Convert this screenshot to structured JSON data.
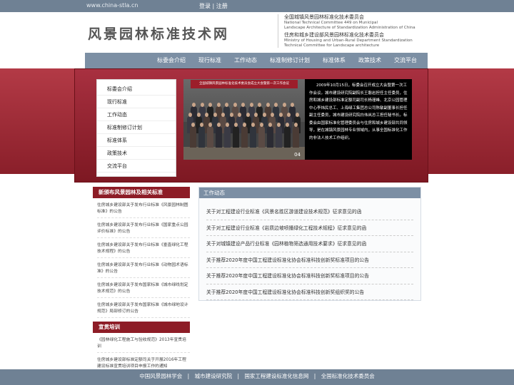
{
  "topbar": {
    "url": "www.china-stla.cn",
    "login": "登录",
    "divider": "|",
    "register": "注册"
  },
  "header": {
    "logo": "风景园林标准技术网",
    "org1_cn": "全国城镇风景园林标准化技术委员会",
    "org1_en1": "National Technical Committee 449 on Municipal",
    "org1_en2": "Landscape Architecture of Standardization Administration of China",
    "org2_cn": "住房和城乡建设部风景园林标准化技术委员会",
    "org2_en1": "Ministry of Housing and Urban-Rural Department Standardization",
    "org2_en2": "Technical Committee for Landscape architecture"
  },
  "nav": [
    "标委会介绍",
    "现行标准",
    "工作动态",
    "标准制修订计划",
    "标准体系",
    "政策技术",
    "交流平台"
  ],
  "side_menu": [
    "标委会介绍",
    "现行标准",
    "工作动态",
    "标准制修订计划",
    "标准体系",
    "政策技术",
    "交流平台"
  ],
  "slider": {
    "photo_title": "全国城镇风景园林标准化技术委员会成立大会暨第一次工作会议",
    "page_num": "04",
    "news_text": "2009年10月15日，标委会召开成立大会暨第一次工作会议。城市建设研究院副院长王磐岩担任主任委员，住房和城乡建设部标准定额司副司长杨瑾峰、北京公园管理中心李炜民总工、上海绿工集团总公司陈敏副董事长担任副主任委员，城市建设研究院白伟岚总工担任秘书长。标委会由国家标准化管理委员会与住房和城乡建设部共同领导，是在城镇风景园林专业领域内，从事全国标准化工作的非法人技术工作组织。"
  },
  "left": {
    "section1_title": "新颁布风景园林及相关标准",
    "items": [
      "住房城乡建设部关于发布行业标准《风景园林制图标准》的公告",
      "住房城乡建设部关于发布行业标准《国家重点公园评价标准》的公告",
      "住房城乡建设部关于发布行业标准《垂直绿化工程技术规程》的公告",
      "住房城乡建设部关于发布行业标准《动物园术语标准》的公告",
      "住房城乡建设部关于发布国家标准《城市绿线划定技术规范》的公告",
      "住房城乡建设部关于发布国家标准《城市绿地设计规范》局部修订的公告"
    ],
    "section2_title": "宣贯培训",
    "items2": [
      "《园林绿化工程施工与验收规范》2013年宣贯培训",
      "住房城乡建设部标准定额司关于开展2016年工程建设标准宣贯培训项目申报工作的通知"
    ]
  },
  "main": {
    "title": "工作动态",
    "items": [
      "关于对工程建设行业标准《风景名胜区游道建设技术规范》征求意见的函",
      "关于对工程建设行业标准《岩质边坡喷播绿化工程技术规程》征求意见的函",
      "关于对城镇建设产品行业标准《园林植物筛选通用技术要求》征求意见的函",
      "关于推荐2020年度中国工程建设标准化协会标准科技创新奖标准项目的公告",
      "关于推荐2020年度中国工程建设标准化协会标准科技创新奖标准项目的公告",
      "关于推荐2020年度中国工程建设标准化协会标准科技创新奖组织奖的公告"
    ]
  },
  "footer": {
    "sep": "|",
    "links": [
      "中国风景园林学会",
      "城市建设研究院",
      "国家工程建设标准化信息网",
      "全国标准化技术委员会"
    ]
  },
  "colors": {
    "topbar": "#6f8194",
    "nav": "#7c8fa4",
    "banner": "#a83040",
    "section_head": "#8d1c26"
  }
}
